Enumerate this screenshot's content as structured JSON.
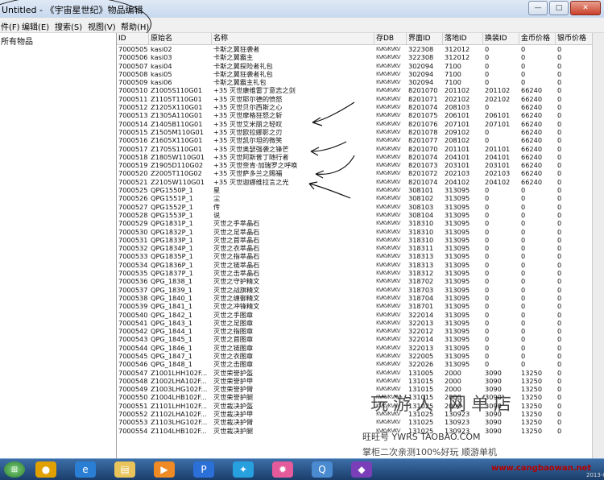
{
  "window": {
    "title": "Untitled - 《宇宙星世纪》物品编辑",
    "min": "—",
    "max": "□",
    "close": "✕"
  },
  "menu": [
    "件(F)",
    "编辑(E)",
    "搜索(S)",
    "视图(V)",
    "帮助(H)"
  ],
  "tree": {
    "root": "所有物品"
  },
  "columns": [
    "ID",
    "原始名",
    "名称",
    "存DB",
    "界面ID",
    "落地ID",
    "换装ID",
    "金币价格",
    "银币价格"
  ],
  "rows": [
    [
      "7000505",
      "kasi02",
      "卡斯之翼狂袭者",
      "KVKVKVKV",
      "322308",
      "312012",
      "0",
      "0",
      "0"
    ],
    [
      "7000506",
      "kasi03",
      "卡斯之翼霸主",
      "KVKVKVKV",
      "322308",
      "312012",
      "0",
      "0",
      "0"
    ],
    [
      "7000507",
      "kasi04",
      "卡斯之翼探险者礼包",
      "KVKVKVKV",
      "302094",
      "7100",
      "0",
      "0",
      "0"
    ],
    [
      "7000508",
      "kasi05",
      "卡斯之翼狂袭者礼包",
      "KVKVKVKV",
      "302094",
      "7100",
      "0",
      "0",
      "0"
    ],
    [
      "7000509",
      "kasi06",
      "卡斯之翼霸主礼包",
      "KVKVKVKV",
      "302094",
      "7100",
      "0",
      "0",
      "0"
    ],
    [
      "7000510",
      "Z1005S110G01",
      "+35 灭世康维雷丁意志之剑",
      "KVKVKVKV",
      "8201070",
      "201102",
      "201102",
      "66240",
      "0"
    ],
    [
      "7000511",
      "Z1105T110G01",
      "+35 灭世耶尔德的愤怒",
      "KVKVKVKV",
      "8201071",
      "202102",
      "202102",
      "66240",
      "0"
    ],
    [
      "7000512",
      "Z1205X110G01",
      "+35 灭世贝尔西斯之心",
      "KVKVKVKV",
      "8201074",
      "208103",
      "0",
      "66240",
      "0"
    ],
    [
      "7000513",
      "Z1305A110G01",
      "+35 灭世摩格狂怒之斩",
      "KVKVKVKV",
      "8201075",
      "206101",
      "206101",
      "66240",
      "0"
    ],
    [
      "7000514",
      "Z1405B110G01",
      "+35 灭世艾米丽之轻叹",
      "KVKVKVKV",
      "8201076",
      "207101",
      "207101",
      "66240",
      "0"
    ],
    [
      "7000515",
      "Z1505M110G01",
      "+35 灭世欧拉娜影之刃",
      "KVKVKVKV",
      "8201078",
      "209102",
      "0",
      "66240",
      "0"
    ],
    [
      "7000516",
      "Z1605X110G01",
      "+35 灭世凯尔坦的微笑",
      "KVKVKVKV",
      "8201077",
      "208102",
      "0",
      "66240",
      "0"
    ],
    [
      "7000517",
      "Z1705S110G01",
      "+35 灭世奥瑟强袭之锋芒",
      "KVKVKVKV",
      "8201070",
      "201101",
      "201101",
      "66240",
      "0"
    ],
    [
      "7000518",
      "Z1805W110G01",
      "+35 灭世阿斯普丁随行者",
      "KVKVKVKV",
      "8201074",
      "204101",
      "204101",
      "66240",
      "0"
    ],
    [
      "7000519",
      "Z1905D110G02",
      "+35 灭世奈肯·加瑞罗之呼唤",
      "KVKVKVKV",
      "8201073",
      "203101",
      "203101",
      "66240",
      "0"
    ],
    [
      "7000520",
      "Z2005T110G02",
      "+35 灭世萨多兰之赐福",
      "KVKVKVKV",
      "8201072",
      "202103",
      "202103",
      "66240",
      "0"
    ],
    [
      "7000521",
      "Z2105W110G01",
      "+35 灭世迦娜维拉言之光",
      "KVKVKVKV",
      "8201074",
      "204102",
      "204102",
      "66240",
      "0"
    ],
    [
      "7000525",
      "QPG1550P_1",
      "星",
      "KVKVKVKV",
      "308101",
      "313095",
      "0",
      "0",
      "0"
    ],
    [
      "7000526",
      "QPG1551P_1",
      "尘",
      "KVKVKVKV",
      "308102",
      "313095",
      "0",
      "0",
      "0"
    ],
    [
      "7000527",
      "QPG1552P_1",
      "传",
      "KVKVKVKV",
      "308103",
      "313095",
      "0",
      "0",
      "0"
    ],
    [
      "7000528",
      "QPG1553P_1",
      "说",
      "KVKVKVKV",
      "308104",
      "313095",
      "0",
      "0",
      "0"
    ],
    [
      "7000529",
      "QPG1831P_1",
      "灭世之手萃晶石",
      "KVKVKVKV",
      "318310",
      "313095",
      "0",
      "0",
      "0"
    ],
    [
      "7000530",
      "QPG1832P_1",
      "灭世之足萃晶石",
      "KVKVKVKV",
      "318310",
      "313095",
      "0",
      "0",
      "0"
    ],
    [
      "7000531",
      "QPG1833P_1",
      "灭世之首萃晶石",
      "KVKVKVKV",
      "318310",
      "313095",
      "0",
      "0",
      "0"
    ],
    [
      "7000532",
      "QPG1834P_1",
      "灭世之衣萃晶石",
      "KVKVKVKV",
      "318311",
      "313095",
      "0",
      "0",
      "0"
    ],
    [
      "7000533",
      "QPG1835P_1",
      "灭世之指萃晶石",
      "KVKVKVKV",
      "318313",
      "313095",
      "0",
      "0",
      "0"
    ],
    [
      "7000534",
      "QPG1836P_1",
      "灭世之链萃晶石",
      "KVKVKVKV",
      "318313",
      "313095",
      "0",
      "0",
      "0"
    ],
    [
      "7000535",
      "QPG1837P_1",
      "灭世之击萃晶石",
      "KVKVKVKV",
      "318312",
      "313095",
      "0",
      "0",
      "0"
    ],
    [
      "7000536",
      "QPG_1838_1",
      "灭世之守护精文",
      "KVKVKVKV",
      "318702",
      "313095",
      "0",
      "0",
      "0"
    ],
    [
      "7000537",
      "QPG_1839_1",
      "灭世之战旗精文",
      "KVKVKVKV",
      "318703",
      "313095",
      "0",
      "0",
      "0"
    ],
    [
      "7000538",
      "QPG_1840_1",
      "灭世之缠御精文",
      "KVKVKVKV",
      "318704",
      "313095",
      "0",
      "0",
      "0"
    ],
    [
      "7000539",
      "QPG_1841_1",
      "灭世之冲锋精文",
      "KVKVKVKV",
      "318701",
      "313095",
      "0",
      "0",
      "0"
    ],
    [
      "7000540",
      "QPG_1842_1",
      "灭世之手图章",
      "KVKVKVKV",
      "322014",
      "313095",
      "0",
      "0",
      "0"
    ],
    [
      "7000541",
      "QPG_1843_1",
      "灭世之足图章",
      "KVKVKVKV",
      "322013",
      "313095",
      "0",
      "0",
      "0"
    ],
    [
      "7000542",
      "QPG_1844_1",
      "灭世之指图章",
      "KVKVKVKV",
      "322012",
      "313095",
      "0",
      "0",
      "0"
    ],
    [
      "7000543",
      "QPG_1845_1",
      "灭世之首图章",
      "KVKVKVKV",
      "322014",
      "313095",
      "0",
      "0",
      "0"
    ],
    [
      "7000544",
      "QPG_1846_1",
      "灭世之链图章",
      "KVKVKVKV",
      "322013",
      "313095",
      "0",
      "0",
      "0"
    ],
    [
      "7000545",
      "QPG_1847_1",
      "灭世之衣图章",
      "KVKVKVKV",
      "322005",
      "313095",
      "0",
      "0",
      "0"
    ],
    [
      "7000546",
      "QPG_1848_1",
      "灭世之击图章",
      "KVKVKVKV",
      "322026",
      "313095",
      "0",
      "0",
      "0"
    ],
    [
      "7000547",
      "Z1001LHH102F...",
      "灭世荣誉护盔",
      "KVKVKVKV",
      "131005",
      "2000",
      "3090",
      "13250",
      "0"
    ],
    [
      "7000548",
      "Z1002LHA102F...",
      "灭世荣誉护甲",
      "KVKVKVKV",
      "131015",
      "2000",
      "3090",
      "13250",
      "0"
    ],
    [
      "7000549",
      "Z1003LHG102F...",
      "灭世荣誉护臂",
      "KVKVKVKV",
      "131015",
      "2000",
      "3090",
      "13250",
      "0"
    ],
    [
      "7000550",
      "Z1004LHB102F...",
      "灭世荣誉护腿",
      "KVKVKVKV",
      "131015",
      "2000",
      "3090",
      "13250",
      "0"
    ],
    [
      "7000551",
      "Z1101LHH102F...",
      "灭世裁决护盔",
      "KVKVKVKV",
      "131025",
      "2000",
      "3090",
      "13250",
      "0"
    ],
    [
      "7000552",
      "Z1102LHA102F...",
      "灭世裁决护甲",
      "KVKVKVKV",
      "131025",
      "130923",
      "3090",
      "13250",
      "0"
    ],
    [
      "7000553",
      "Z1103LHG102F...",
      "灭世裁决护臂",
      "KVKVKVKV",
      "131025",
      "130923",
      "3090",
      "13250",
      "0"
    ],
    [
      "7000554",
      "Z1104LHB102F...",
      "灭世裁决护腿",
      "KVKVKVKV",
      "131025",
      "130923",
      "3090",
      "13250",
      "0"
    ]
  ],
  "taskbar": {
    "start": "⊞",
    "icons": [
      {
        "name": "qq-icon",
        "glyph": "●",
        "color": "#e0a000"
      },
      {
        "name": "ie-icon",
        "glyph": "e",
        "color": "#2a7fd4"
      },
      {
        "name": "folder-icon",
        "glyph": "▤",
        "color": "#e8c45a"
      },
      {
        "name": "media-player-icon",
        "glyph": "▶",
        "color": "#f08a24"
      },
      {
        "name": "player-icon",
        "glyph": "P",
        "color": "#2b6fd8"
      },
      {
        "name": "app-icon",
        "glyph": "✦",
        "color": "#27a0e0"
      },
      {
        "name": "color-wheel-icon",
        "glyph": "✹",
        "color": "#e45a9a"
      },
      {
        "name": "search-tool-icon",
        "glyph": "Q",
        "color": "#4a8ad0"
      },
      {
        "name": "editor-icon",
        "glyph": "◆",
        "color": "#7a3fb8"
      }
    ],
    "date": "2013-0"
  },
  "watermark": {
    "line1": "玩游人 网单店",
    "line2": "旺旺号 YWRS TAOBAO.COM",
    "line3": "掌柜二次亲测100%好玩 顺游单机",
    "line4": "www.cangbaowan.net"
  }
}
